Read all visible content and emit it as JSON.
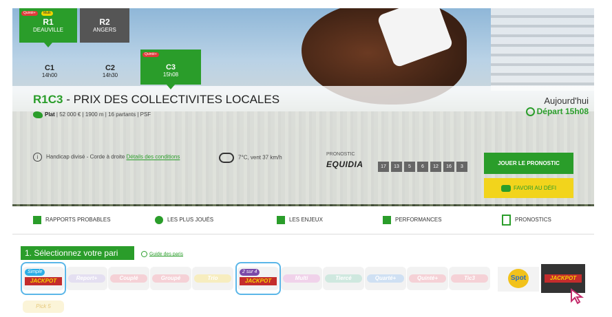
{
  "reunions": [
    {
      "code": "R1",
      "city": "DEAUVILLE",
      "badges": [
        "Quinté+",
        "Multi"
      ]
    },
    {
      "code": "R2",
      "city": "ANGERS"
    }
  ],
  "courses": [
    {
      "code": "C1",
      "time": "14h00"
    },
    {
      "code": "C2",
      "time": "14h30"
    },
    {
      "code": "C3",
      "time": "15h08",
      "badge": "Quinté+"
    }
  ],
  "race": {
    "code": "R1C3",
    "sep": " - ",
    "name": "PRIX DES COLLECTIVITES LOCALES",
    "type": "Plat",
    "details": "| 52 000 € | 1900 m | 16 partants | PSF",
    "day": "Aujourd'hui",
    "depart": "Départ 15h08",
    "condition": "Handicap divisé - Corde à droite",
    "conditions_link": "Détails des conditions",
    "weather": "7°C, vent 37 km/h"
  },
  "prono": {
    "label": "PRONOSTIC",
    "source": "EQUIDIA",
    "numbers": [
      "17",
      "13",
      "5",
      "6",
      "12",
      "16",
      "3"
    ],
    "play_label": "JOUER LE PRONOSTIC",
    "fav_label": "FAVORI AU DÉFI"
  },
  "nav": [
    "RAPPORTS PROBABLES",
    "LES PLUS JOUÉS",
    "LES ENJEUX",
    "PERFORMANCES",
    "PRONOSTICS"
  ],
  "paris": {
    "step": "1. Sélectionnez votre pari",
    "guide": "Guide des paris",
    "bets": [
      {
        "label": "Simple",
        "jackpot": "JACKPOT",
        "selected": true
      },
      {
        "label": "Report+"
      },
      {
        "label": "Couplé"
      },
      {
        "label": "Groupé"
      },
      {
        "label": "Trio"
      },
      {
        "label": "2 sur 4",
        "jackpot": "JACKPOT",
        "selected": true
      },
      {
        "label": "Multi"
      },
      {
        "label": "Tiercé"
      },
      {
        "label": "Quarté+"
      },
      {
        "label": "Quinté+"
      },
      {
        "label": "Tic3"
      }
    ],
    "spot": "Spot",
    "jackpot_black": "JACKPOT",
    "pick5": "Pick 5"
  },
  "colors": {
    "green": "#2a9d2a",
    "yellow": "#f2d41c",
    "jackpot_red": "#c42c2c",
    "select_blue": "#5ab6e8"
  }
}
